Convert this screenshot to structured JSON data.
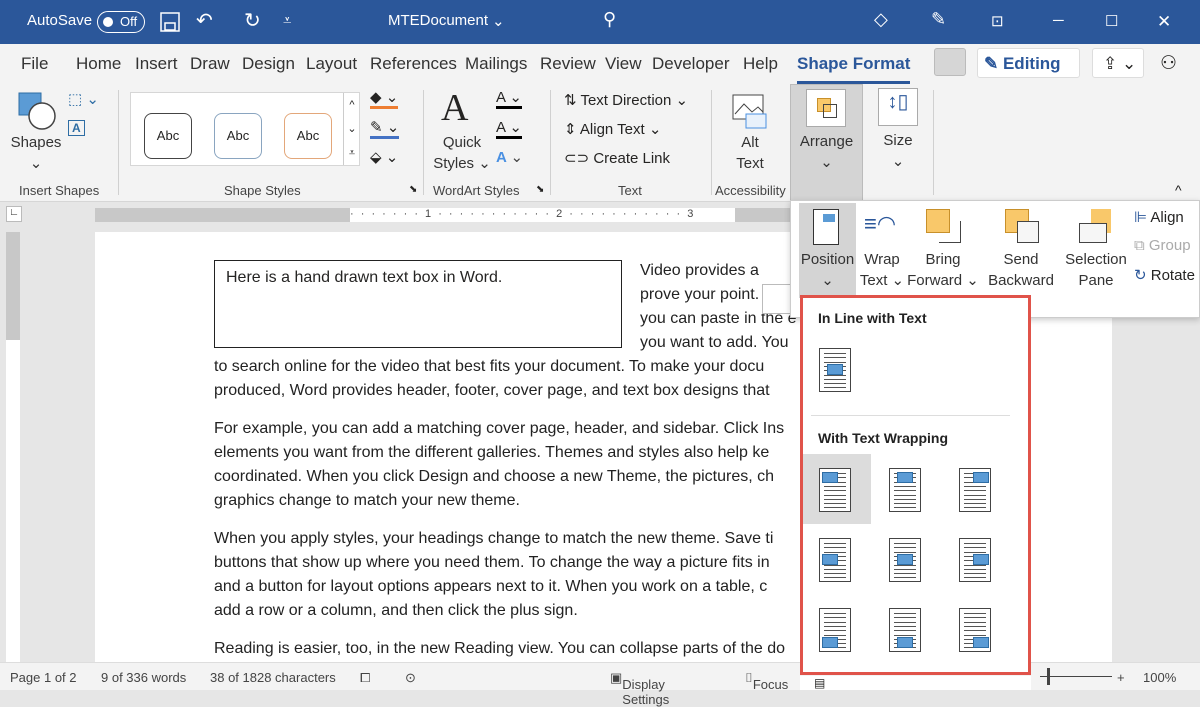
{
  "title_bar": {
    "autosave_label": "AutoSave",
    "autosave_state": "Off",
    "doc_name": "MTEDocument"
  },
  "tabs": [
    "File",
    "Home",
    "Insert",
    "Draw",
    "Design",
    "Layout",
    "References",
    "Mailings",
    "Review",
    "View",
    "Developer",
    "Help",
    "Shape Format"
  ],
  "active_tab": "Shape Format",
  "editing_label": "Editing",
  "ribbon": {
    "insert_shapes": {
      "shapes": "Shapes",
      "group": "Insert Shapes"
    },
    "shape_styles": {
      "samples": [
        "Abc",
        "Abc",
        "Abc"
      ],
      "group": "Shape Styles"
    },
    "wordart": {
      "quick": "Quick",
      "styles": "Styles",
      "group": "WordArt Styles"
    },
    "text": {
      "direction": "Text Direction",
      "align": "Align Text",
      "link": "Create Link",
      "group": "Text"
    },
    "accessibility": {
      "alt1": "Alt",
      "alt2": "Text",
      "group": "Accessibility"
    },
    "arrange": "Arrange",
    "size": "Size"
  },
  "arrange_menu": {
    "position": "Position",
    "wrap1": "Wrap",
    "wrap2": "Text",
    "bring1": "Bring",
    "bring2": "Forward",
    "send1": "Send",
    "send2": "Backward",
    "sel1": "Selection",
    "sel2": "Pane",
    "align": "Align",
    "group": "Group",
    "rotate": "Rotate"
  },
  "position_gallery": {
    "inline_header": "In Line with Text",
    "wrap_header": "With Text Wrapping"
  },
  "document": {
    "textbox": "Here is a hand drawn text box in Word.",
    "side_lines": [
      "Video provides a",
      "prove your point. W",
      "you can paste in the e",
      "you want to add. You"
    ],
    "lines": [
      "to search online for the video that best fits your document. To make your docu",
      "produced, Word provides header, footer, cover page, and text box designs that"
    ],
    "para2": [
      "For example, you can add a matching cover page, header, and sidebar. Click Ins",
      "elements you want from the different galleries. Themes and styles also help ke",
      "coordinated. When you click Design and choose a new Theme, the pictures, ch",
      "graphics change to match your new theme."
    ],
    "para3": [
      "When you apply styles, your headings change to match the new theme. Save ti",
      "buttons that show up where you need them. To change the way a picture fits in",
      "and a button for layout options appears next to it. When you work on a table, c",
      "add a row or a column, and then click the plus sign."
    ],
    "para4": [
      "Reading is easier, too, in the new Reading view. You can collapse parts of the do"
    ]
  },
  "status": {
    "page": "Page 1 of 2",
    "words": "9 of 336 words",
    "chars": "38 of 1828 characters",
    "display": "Display Settings",
    "focus": "Focus",
    "zoom": "100%"
  },
  "colors": {
    "brand": "#2b579a",
    "highlight": "#e0534a"
  }
}
